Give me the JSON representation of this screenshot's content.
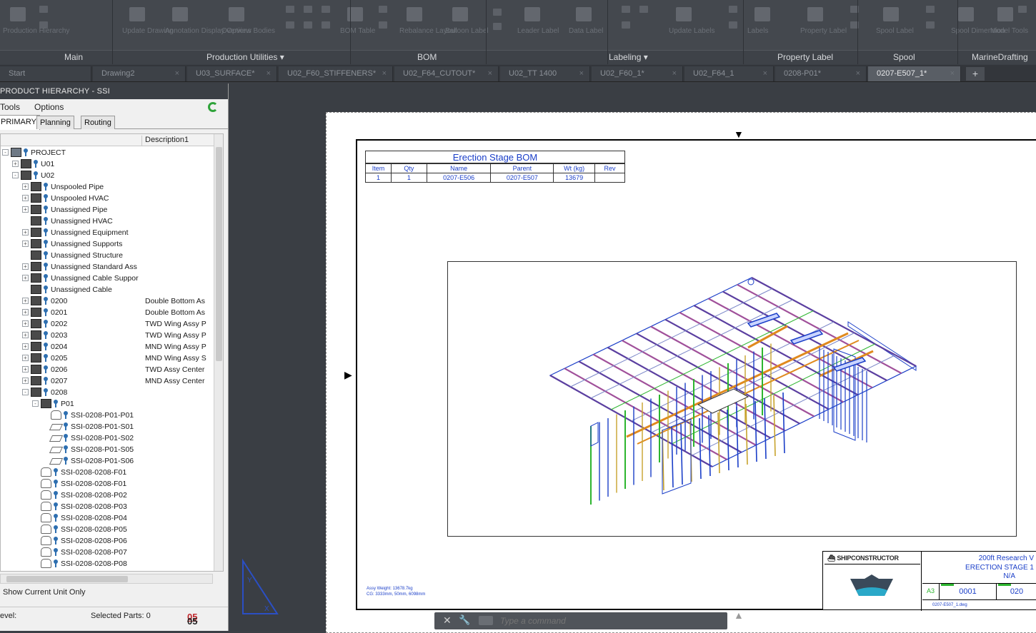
{
  "ribbon": {
    "panels": [
      "Main",
      "Production Utilities",
      "BOM",
      "Labeling",
      "Property Label",
      "Spool",
      "MarineDrafting"
    ],
    "button_labels": [
      "Production Hierarchy",
      "Update Drawing",
      "Annotation Display Options",
      "Overview Bodies",
      "BOM Table",
      "Rebalance Layout",
      "Balloon Label",
      "Leader Label",
      "Data Label",
      "Update Labels",
      "Labels",
      "Property Label",
      "Spool Label",
      "Spool Dimension",
      "Model Tools",
      "Update Label"
    ]
  },
  "doc_tabs": {
    "items": [
      "Start",
      "Drawing2",
      "U03_SURFACE*",
      "U02_F60_STIFFENERS*",
      "U02_F64_CUTOUT*",
      "U02_TT 1400",
      "U02_F60_1*",
      "U02_F64_1",
      "0208-P01*",
      "0207-E507_1*"
    ],
    "active": "0207-E507_1*",
    "close_glyph": "×",
    "add_glyph": "+"
  },
  "palette": {
    "title": "PRODUCT HIERARCHY - SSI",
    "menu": [
      "Tools",
      "Options"
    ],
    "tabs": [
      "PRIMARY",
      "Planning",
      "Routing"
    ],
    "column_desc": "Description1",
    "tree": [
      {
        "label": "PROJECT",
        "desc": "",
        "icon": "project"
      },
      {
        "label": "U01",
        "desc": "",
        "icon": "unit"
      },
      {
        "label": "U02",
        "desc": "",
        "icon": "unit"
      },
      {
        "label": "Unspooled Pipe",
        "desc": "",
        "icon": "assy"
      },
      {
        "label": "Unspooled HVAC",
        "desc": "",
        "icon": "assy"
      },
      {
        "label": "Unassigned Pipe",
        "desc": "",
        "icon": "assy"
      },
      {
        "label": "Unassigned HVAC",
        "desc": "",
        "icon": "assy"
      },
      {
        "label": "Unassigned Equipment",
        "desc": "",
        "icon": "assy"
      },
      {
        "label": "Unassigned Supports",
        "desc": "",
        "icon": "assy"
      },
      {
        "label": "Unassigned Structure",
        "desc": "",
        "icon": "assy"
      },
      {
        "label": "Unassigned Standard Ass",
        "desc": "",
        "icon": "assy"
      },
      {
        "label": "Unassigned Cable Suppor",
        "desc": "",
        "icon": "assy"
      },
      {
        "label": "Unassigned Cable",
        "desc": "",
        "icon": "assy"
      },
      {
        "label": "0200",
        "desc": "Double Bottom As",
        "icon": "assy"
      },
      {
        "label": "0201",
        "desc": "Double Bottom As",
        "icon": "assy"
      },
      {
        "label": "0202",
        "desc": "TWD Wing Assy P",
        "icon": "assy"
      },
      {
        "label": "0203",
        "desc": "TWD Wing Assy P",
        "icon": "assy"
      },
      {
        "label": "0204",
        "desc": "MND Wing Assy P",
        "icon": "assy"
      },
      {
        "label": "0205",
        "desc": "MND Wing Assy S",
        "icon": "assy"
      },
      {
        "label": "0206",
        "desc": "TWD Assy Center",
        "icon": "assy"
      },
      {
        "label": "0207",
        "desc": "MND Assy Center",
        "icon": "assy"
      },
      {
        "label": "0208",
        "desc": "",
        "icon": "assy"
      },
      {
        "label": "P01",
        "desc": "",
        "icon": "assy"
      },
      {
        "label": "SSI-0208-P01-P01",
        "desc": "",
        "icon": "part"
      },
      {
        "label": "SSI-0208-P01-S01",
        "desc": "",
        "icon": "plate"
      },
      {
        "label": "SSI-0208-P01-S02",
        "desc": "",
        "icon": "plate"
      },
      {
        "label": "SSI-0208-P01-S05",
        "desc": "",
        "icon": "plate"
      },
      {
        "label": "SSI-0208-P01-S06",
        "desc": "",
        "icon": "plate"
      },
      {
        "label": "SSI-0208-0208-F01",
        "desc": "",
        "icon": "part"
      },
      {
        "label": "SSI-0208-0208-F01",
        "desc": "",
        "icon": "part"
      },
      {
        "label": "SSI-0208-0208-P02",
        "desc": "",
        "icon": "part"
      },
      {
        "label": "SSI-0208-0208-P03",
        "desc": "",
        "icon": "part"
      },
      {
        "label": "SSI-0208-0208-P04",
        "desc": "",
        "icon": "part"
      },
      {
        "label": "SSI-0208-0208-P05",
        "desc": "",
        "icon": "part"
      },
      {
        "label": "SSI-0208-0208-P06",
        "desc": "",
        "icon": "part"
      },
      {
        "label": "SSI-0208-0208-P07",
        "desc": "",
        "icon": "part"
      },
      {
        "label": "SSI-0208-0208-P08",
        "desc": "",
        "icon": "part"
      }
    ],
    "show_current": "Show Current Unit Only",
    "level_label": "evel:",
    "selected_parts": "Selected Parts: 0",
    "logo_a": "05",
    "logo_b": "05"
  },
  "drawing": {
    "bom_title": "Erection Stage BOM",
    "bom_headers": [
      "Item",
      "Qty",
      "Name",
      "Parent",
      "Wt (kg)",
      "Rev"
    ],
    "bom_row": [
      "1",
      "1",
      "0207-E506",
      "0207-E507",
      "13679",
      ""
    ],
    "note_1": "Assy Weight: 13678.7kg",
    "note_2": "CG: 3333mm, 50mm, 6098mm",
    "title_block": {
      "brand": "SHIPCONSTRUCTOR",
      "line1": "200ft Research V",
      "line2": "ERECTION STAGE 1",
      "line3": "N/A",
      "size": "A3",
      "sheet": "0001",
      "drawing_no": "020",
      "file": "0207-E507_1.dwg"
    }
  },
  "command": {
    "placeholder": "Type a command",
    "close": "✕",
    "wrench": "🔧"
  },
  "colors": {
    "accent_blue": "#1a3ec8",
    "green": "#2db52f",
    "orange": "#e08a1e",
    "purple": "#5b3fa0"
  }
}
